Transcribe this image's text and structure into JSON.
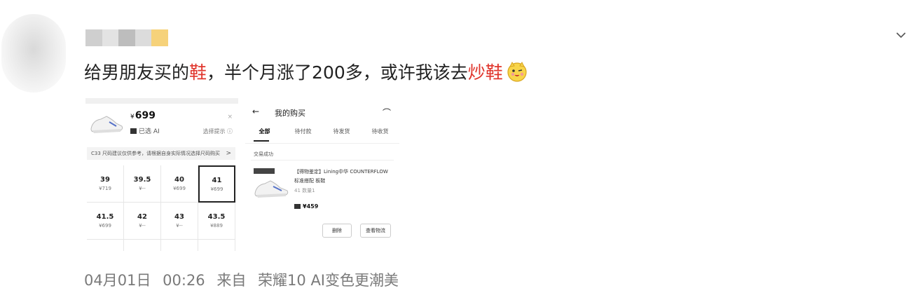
{
  "post": {
    "text_before": "给男朋友买的",
    "text_hl1": "鞋",
    "text_mid": "，半个月涨了200多，或许我该去",
    "text_hl2": "炒鞋",
    "emoji": "cheeky-face-emoji"
  },
  "username_blur_colors": [
    "#cfcfcf",
    "#e3e3e3",
    "#bdbdbd",
    "#dcdcdc",
    "#f6d27a"
  ],
  "footer": {
    "date": "04月01日",
    "time": "00:26",
    "source_prefix": "来自",
    "source": "荣耀10 AI变色更潮美"
  },
  "screenshot_1": {
    "price_symbol": "¥",
    "price": "699",
    "brand": "已选 AI",
    "close": "×",
    "notice_link": "选择提示 ⓘ",
    "info_bar": "C33 尺码建议仅供参考，请根据自身实际情况选择尺码购买",
    "info_arrow": ">",
    "sizes": [
      {
        "size": "39",
        "price": "¥719"
      },
      {
        "size": "39.5",
        "price": "¥--"
      },
      {
        "size": "40",
        "price": "¥699"
      },
      {
        "size": "41",
        "price": "¥699",
        "selected": true
      },
      {
        "size": "41.5",
        "price": "¥699"
      },
      {
        "size": "42",
        "price": "¥--"
      },
      {
        "size": "43",
        "price": "¥--"
      },
      {
        "size": "43.5",
        "price": "¥889"
      },
      {
        "size": "",
        "price": ""
      },
      {
        "size": "",
        "price": ""
      },
      {
        "size": "",
        "price": ""
      },
      {
        "size": "",
        "price": ""
      }
    ]
  },
  "screenshot_2": {
    "back": "←",
    "title": "我的购买",
    "headset": "⌒",
    "tabs": [
      "全部",
      "待付款",
      "待发货",
      "待收货"
    ],
    "status": "交易成功",
    "item_name": "【得物鉴定】Lining中华 COUNTERFLOW 标准搭配 板鞋",
    "item_sub": "41 数量1",
    "item_price": "¥459",
    "buttons": [
      "删除",
      "查看物流"
    ]
  }
}
